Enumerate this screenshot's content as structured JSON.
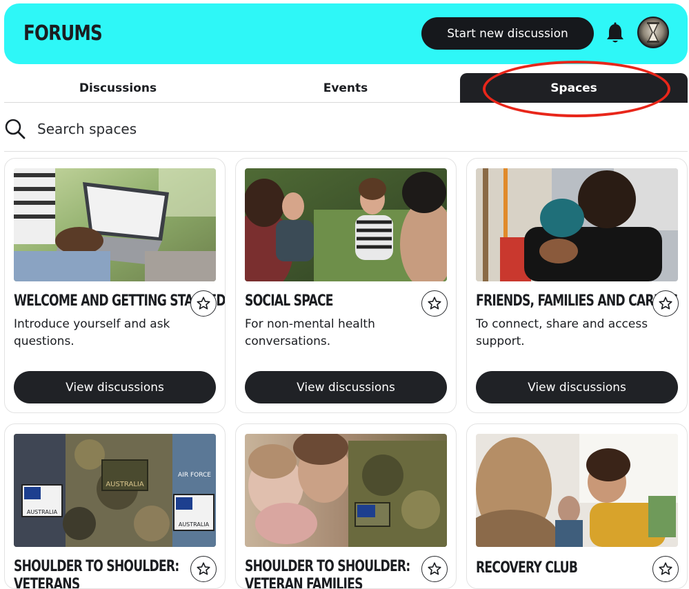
{
  "header": {
    "title": "FORUMS",
    "new_discussion_label": "Start new discussion",
    "bell_icon": "bell-icon",
    "avatar_icon": "avatar",
    "background_color": "#2ef7f7"
  },
  "tabs": [
    {
      "label": "Discussions",
      "active": false
    },
    {
      "label": "Events",
      "active": false
    },
    {
      "label": "Spaces",
      "active": true
    }
  ],
  "search": {
    "placeholder": "Search spaces",
    "icon": "search-icon"
  },
  "spaces": [
    {
      "title": "WELCOME AND GETTING STARTED",
      "description": "Introduce yourself and ask questions.",
      "button": "View discussions",
      "favorite_icon": "star-icon"
    },
    {
      "title": "SOCIAL SPACE",
      "description": "For non-mental health conversations.",
      "button": "View discussions",
      "favorite_icon": "star-icon"
    },
    {
      "title": "FRIENDS, FAMILIES AND CARERS",
      "description": "To connect, share and access support.",
      "button": "View discussions",
      "favorite_icon": "star-icon"
    },
    {
      "title": "SHOULDER TO SHOULDER: VETERANS",
      "description": "",
      "button": "",
      "favorite_icon": "star-icon"
    },
    {
      "title": "SHOULDER TO SHOULDER: VETERAN FAMILIES",
      "description": "",
      "button": "",
      "favorite_icon": "star-icon"
    },
    {
      "title": "RECOVERY CLUB",
      "description": "",
      "button": "",
      "favorite_icon": "star-icon"
    }
  ],
  "image_patches": {
    "patch_1": "AIR FORCE",
    "patch_2": "AUSTRALIA",
    "patch_3": "AUSTRALIA",
    "patch_4": "AUSTRALIA"
  },
  "colors": {
    "accent": "#2ef7f7",
    "dark": "#1f2024",
    "annotation": "#e8261a"
  }
}
